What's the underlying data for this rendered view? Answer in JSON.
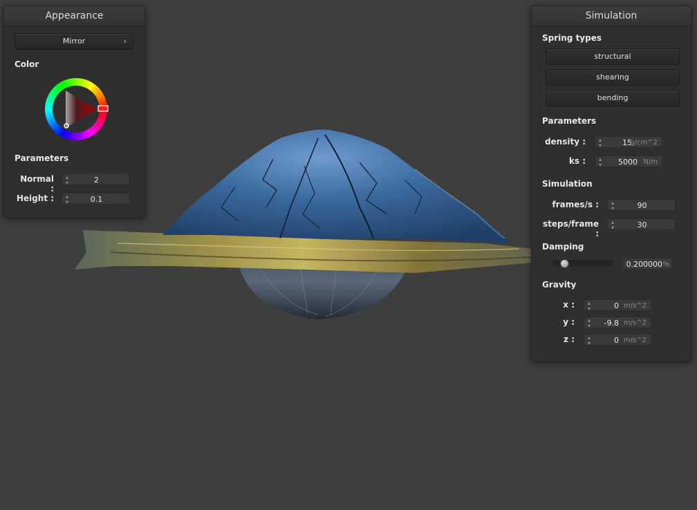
{
  "appearance": {
    "title": "Appearance",
    "shader_dropdown": {
      "selected": "Mirror",
      "chevron": "›"
    },
    "color_label": "Color",
    "color_picker": {
      "color": "#ff2020"
    },
    "parameters_label": "Parameters",
    "normal": {
      "label": "Normal :",
      "value": "2"
    },
    "height": {
      "label": "Height :",
      "value": "0.1"
    }
  },
  "simulation": {
    "title": "Simulation",
    "spring_types_label": "Spring types",
    "springs": [
      {
        "label": "structural"
      },
      {
        "label": "shearing"
      },
      {
        "label": "bending"
      }
    ],
    "parameters_label": "Parameters",
    "density": {
      "label": "density :",
      "value": "15",
      "unit": "g/cm^2"
    },
    "ks": {
      "label": "ks :",
      "value": "5000",
      "unit": "N/m"
    },
    "simulation_label": "Simulation",
    "frames": {
      "label": "frames/s :",
      "value": "90"
    },
    "steps": {
      "label": "steps/frame :",
      "value": "30"
    },
    "damping_label": "Damping",
    "damping": {
      "value": "0.200000",
      "unit": "%",
      "fraction": 0.2
    },
    "gravity_label": "Gravity",
    "gravity": [
      {
        "label": "x :",
        "value": "0",
        "unit": "m/s^2"
      },
      {
        "label": "y :",
        "value": "-9.8",
        "unit": "m/s^2"
      },
      {
        "label": "z :",
        "value": "0",
        "unit": "m/s^2"
      }
    ]
  },
  "scene": {
    "cloth_color": "#2f5d8e",
    "sphere_color": "#4b5b6a",
    "background": "#3e3e3e"
  }
}
